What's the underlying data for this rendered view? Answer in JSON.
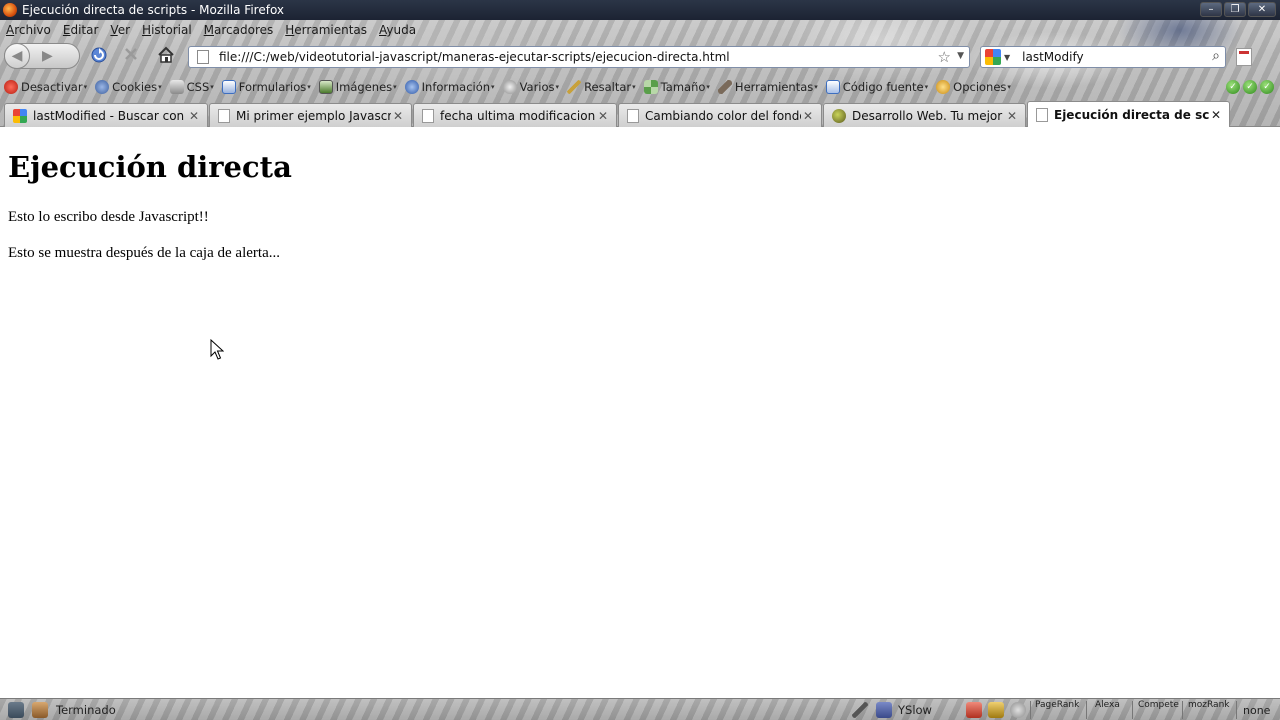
{
  "window": {
    "title": "Ejecución directa de scripts - Mozilla Firefox",
    "buttons": [
      "–",
      "❐",
      "✕"
    ]
  },
  "menu": [
    "Archivo",
    "Editar",
    "Ver",
    "Historial",
    "Marcadores",
    "Herramientas",
    "Ayuda"
  ],
  "navigation": {
    "url": "file:///C:/web/videotutorial-javascript/maneras-ejecutar-scripts/ejecucion-directa.html",
    "search_query": "lastModify"
  },
  "devtoolbar": [
    {
      "label": "Desactivar",
      "icon": "disable-icon",
      "color": "#d93a2b"
    },
    {
      "label": "Cookies",
      "icon": "cookies-icon",
      "color": "#4a6fa8"
    },
    {
      "label": "CSS",
      "icon": "css-icon",
      "color": "#7a7a7a"
    },
    {
      "label": "Formularios",
      "icon": "forms-icon",
      "color": "#3d6ebf"
    },
    {
      "label": "Imágenes",
      "icon": "images-icon",
      "color": "#5a8f3c"
    },
    {
      "label": "Información",
      "icon": "info-icon",
      "color": "#3d6ebf"
    },
    {
      "label": "Varios",
      "icon": "misc-icon",
      "color": "#8a8a8a"
    },
    {
      "label": "Resaltar",
      "icon": "highlight-icon",
      "color": "#c8a13a"
    },
    {
      "label": "Tamaño",
      "icon": "resize-icon",
      "color": "#4a8f4a"
    },
    {
      "label": "Herramientas",
      "icon": "tools-icon",
      "color": "#7a6a5a"
    },
    {
      "label": "Código fuente",
      "icon": "source-icon",
      "color": "#3d6ebf"
    },
    {
      "label": "Opciones",
      "icon": "options-icon",
      "color": "#d4a020"
    }
  ],
  "tabs": [
    {
      "label": "lastModified - Buscar con ...",
      "icon": "google"
    },
    {
      "label": "Mi primer ejemplo Javascript",
      "icon": "page"
    },
    {
      "label": "fecha ultima modificacion",
      "icon": "page"
    },
    {
      "label": "Cambiando color del fondo",
      "icon": "page"
    },
    {
      "label": "Desarrollo Web. Tu mejor a...",
      "icon": "desweb"
    },
    {
      "label": "Ejecución directa de scripts",
      "icon": "page",
      "active": true
    }
  ],
  "page": {
    "heading": "Ejecución directa",
    "paragraph1": "Esto lo escribo desde Javascript!!",
    "paragraph2": "Esto se muestra después de la caja de alerta..."
  },
  "status": {
    "text": "Terminado",
    "yslow": "YSlow",
    "pagerank": "PageRank",
    "alexa": "Alexa",
    "compete": "Compete",
    "mozrank": "mozRank",
    "none": "none"
  }
}
